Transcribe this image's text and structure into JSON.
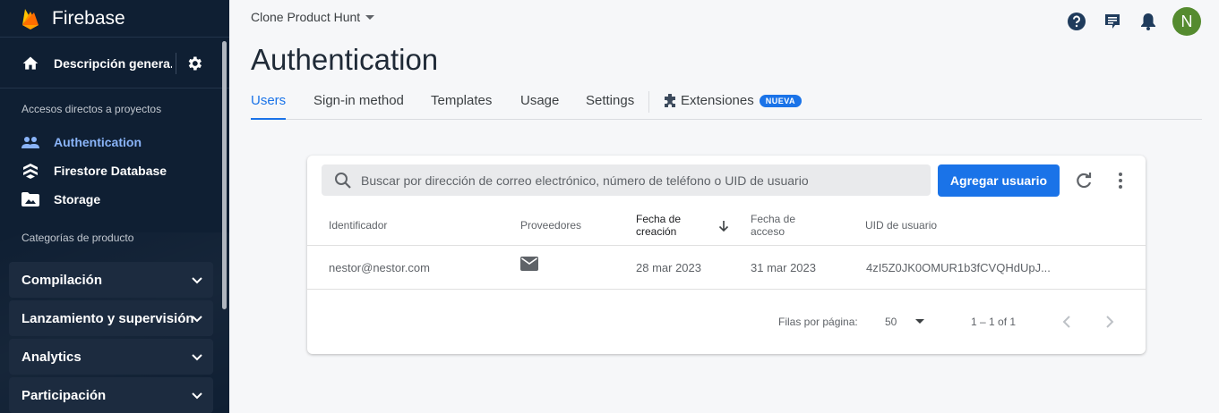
{
  "sidebar": {
    "brand": "Firebase",
    "overview_label": "Descripción genera...",
    "shortcuts_label": "Accesos directos a proyectos",
    "items": [
      {
        "label": "Authentication",
        "icon": "people-icon"
      },
      {
        "label": "Firestore Database",
        "icon": "firestore-icon"
      },
      {
        "label": "Storage",
        "icon": "storage-icon"
      }
    ],
    "categories_label": "Categorías de producto",
    "categories": [
      {
        "label": "Compilación"
      },
      {
        "label": "Lanzamiento y supervisión"
      },
      {
        "label": "Analytics"
      },
      {
        "label": "Participación"
      }
    ]
  },
  "header": {
    "project": "Clone Product Hunt",
    "avatar_initial": "N",
    "avatar_color": "#558b2f"
  },
  "page": {
    "title": "Authentication",
    "tabs": [
      {
        "label": "Users"
      },
      {
        "label": "Sign-in method"
      },
      {
        "label": "Templates"
      },
      {
        "label": "Usage"
      },
      {
        "label": "Settings"
      }
    ],
    "extensions_tab": "Extensiones",
    "extensions_badge": "NUEVA"
  },
  "users": {
    "search_placeholder": "Buscar por dirección de correo electrónico, número de teléfono o UID de usuario",
    "add_button": "Agregar usuario",
    "columns": {
      "id": "Identificador",
      "providers": "Proveedores",
      "created_1": "Fecha de",
      "created_2": "creación",
      "access_1": "Fecha de",
      "access_2": "acceso",
      "uid": "UID de usuario"
    },
    "rows": [
      {
        "id": "nestor@nestor.com",
        "provider": "mail-icon",
        "created": "28 mar 2023",
        "access": "31 mar 2023",
        "uid": "4zI5Z0JK0OMUR1b3fCVQHdUpJ..."
      }
    ],
    "rows_per_page_label": "Filas por página:",
    "rows_per_page": "50",
    "range": "1 – 1 of 1"
  },
  "colors": {
    "accent": "#1a73e8",
    "sidebar_bg": "#0f1f33",
    "sidebar_active": "#8ab4f8"
  }
}
